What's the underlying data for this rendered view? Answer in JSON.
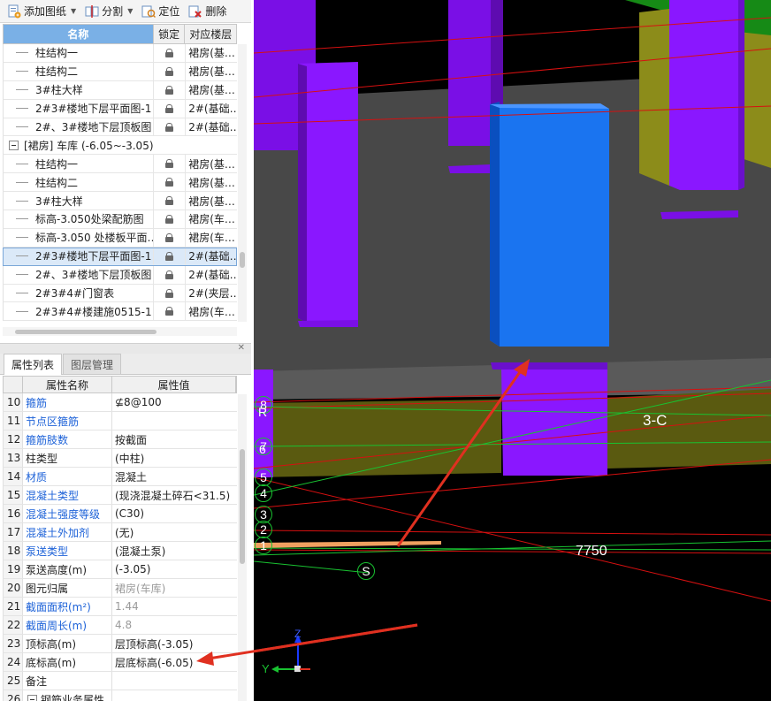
{
  "toolbar": {
    "add_drawing": "添加图纸",
    "split": "分割",
    "locate": "定位",
    "delete": "删除"
  },
  "drawing_list": {
    "headers": {
      "name": "名称",
      "lock": "锁定",
      "floor": "对应楼层"
    },
    "rows": [
      {
        "name": "柱结构一",
        "floor": "裙房(基…"
      },
      {
        "name": "柱结构二",
        "floor": "裙房(基…"
      },
      {
        "name": "3#柱大样",
        "floor": "裙房(基…"
      },
      {
        "name": "2#3#楼地下层平面图-1",
        "floor": "2#(基础…"
      },
      {
        "name": "2#、3#楼地下层顶板图",
        "floor": "2#(基础…"
      }
    ],
    "group": "[裙房] 车库 (-6.05~-3.05)",
    "group_rows": [
      {
        "name": "柱结构一",
        "floor": "裙房(基…"
      },
      {
        "name": "柱结构二",
        "floor": "裙房(基…"
      },
      {
        "name": "3#柱大样",
        "floor": "裙房(基…"
      },
      {
        "name": "标高-3.050处梁配筋图",
        "floor": "裙房(车…"
      },
      {
        "name": "标高-3.050 处楼板平面…",
        "floor": "裙房(车…"
      },
      {
        "name": "2#3#楼地下层平面图-1",
        "floor": "2#(基础…",
        "selected": true
      },
      {
        "name": "2#、3#楼地下层顶板图",
        "floor": "2#(基础…"
      },
      {
        "name": "2#3#4#门窗表",
        "floor": "2#(夹层…"
      },
      {
        "name": "2#3#4#楼建施0515-1…",
        "floor": "裙房(车…"
      }
    ]
  },
  "tabs": {
    "properties": "属性列表",
    "layers": "图层管理"
  },
  "properties": {
    "headers": {
      "name": "属性名称",
      "value": "属性值"
    },
    "rows": [
      {
        "num": "10",
        "name": "箍筋",
        "value": "⊈8@100",
        "name_color": "blue"
      },
      {
        "num": "11",
        "name": "节点区箍筋",
        "value": "",
        "name_color": "blue"
      },
      {
        "num": "12",
        "name": "箍筋肢数",
        "value": "按截面",
        "name_color": "blue"
      },
      {
        "num": "13",
        "name": "柱类型",
        "value": "(中柱)",
        "name_color": "normal"
      },
      {
        "num": "14",
        "name": "材质",
        "value": "混凝土",
        "name_color": "blue"
      },
      {
        "num": "15",
        "name": "混凝土类型",
        "value": "(现浇混凝土碎石<31.5)",
        "name_color": "blue"
      },
      {
        "num": "16",
        "name": "混凝土强度等级",
        "value": "(C30)",
        "name_color": "blue"
      },
      {
        "num": "17",
        "name": "混凝土外加剂",
        "value": "(无)",
        "name_color": "blue"
      },
      {
        "num": "18",
        "name": "泵送类型",
        "value": "(混凝土泵)",
        "name_color": "blue"
      },
      {
        "num": "19",
        "name": "泵送高度(m)",
        "value": "(-3.05)",
        "name_color": "normal"
      },
      {
        "num": "20",
        "name": "图元归属",
        "value": "裙房(车库)",
        "name_color": "normal",
        "value_grey": true
      },
      {
        "num": "21",
        "name": "截面面积(m²)",
        "value": "1.44",
        "name_color": "blue",
        "value_grey": true
      },
      {
        "num": "22",
        "name": "截面周长(m)",
        "value": "4.8",
        "name_color": "blue",
        "value_grey": true
      },
      {
        "num": "23",
        "name": "顶标高(m)",
        "value": "层顶标高(-3.05)",
        "name_color": "normal"
      },
      {
        "num": "24",
        "name": "底标高(m)",
        "value": "层底标高(-6.05)",
        "name_color": "normal"
      },
      {
        "num": "25",
        "name": "备注",
        "value": "",
        "name_color": "normal"
      },
      {
        "num": "26",
        "name": "钢筋业务属性",
        "value": "",
        "name_color": "normal",
        "group": true
      }
    ]
  },
  "viewport": {
    "grid_labels": {
      "axis_3c": "3-C",
      "dim_7750": "7750",
      "s": "S",
      "r": "R",
      "n8": "8",
      "n7": "7",
      "n6": "6",
      "n5": "5",
      "n4": "4",
      "n3": "3",
      "n2": "2",
      "n1": "1"
    },
    "axes": {
      "z": "Z",
      "y": "Y"
    },
    "colors": {
      "column_purple": "#8a17ff",
      "selected_column_blue": "#1a74f0",
      "slab_grey": "#4a4a4a",
      "wall_olive": "#5a5a10",
      "grid_red": "#d61010",
      "grid_green": "#19c231",
      "arrow_red": "#e03020"
    }
  }
}
